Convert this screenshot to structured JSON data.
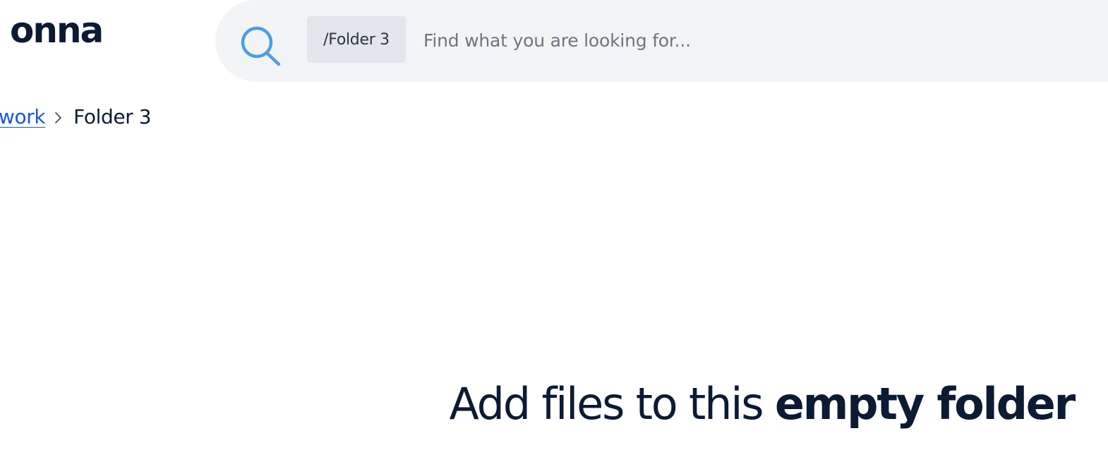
{
  "header": {
    "logo_text": "onna",
    "search": {
      "scope_chip": "/Folder 3",
      "placeholder": "Find what you are looking for..."
    }
  },
  "breadcrumb": {
    "parent_label": "work",
    "current_label": "Folder 3"
  },
  "empty_state": {
    "title_normal": "Add files to this ",
    "title_bold": "empty folder"
  },
  "colors": {
    "brand_navy": "#0c1a33",
    "link_blue": "#1a56db",
    "search_icon_blue": "#4a9eea",
    "search_bar_bg": "#f3f4f6",
    "chip_bg": "#e3e6ea"
  },
  "icons": {
    "search": "search-icon",
    "breadcrumb_separator": "chevron-right-icon"
  }
}
